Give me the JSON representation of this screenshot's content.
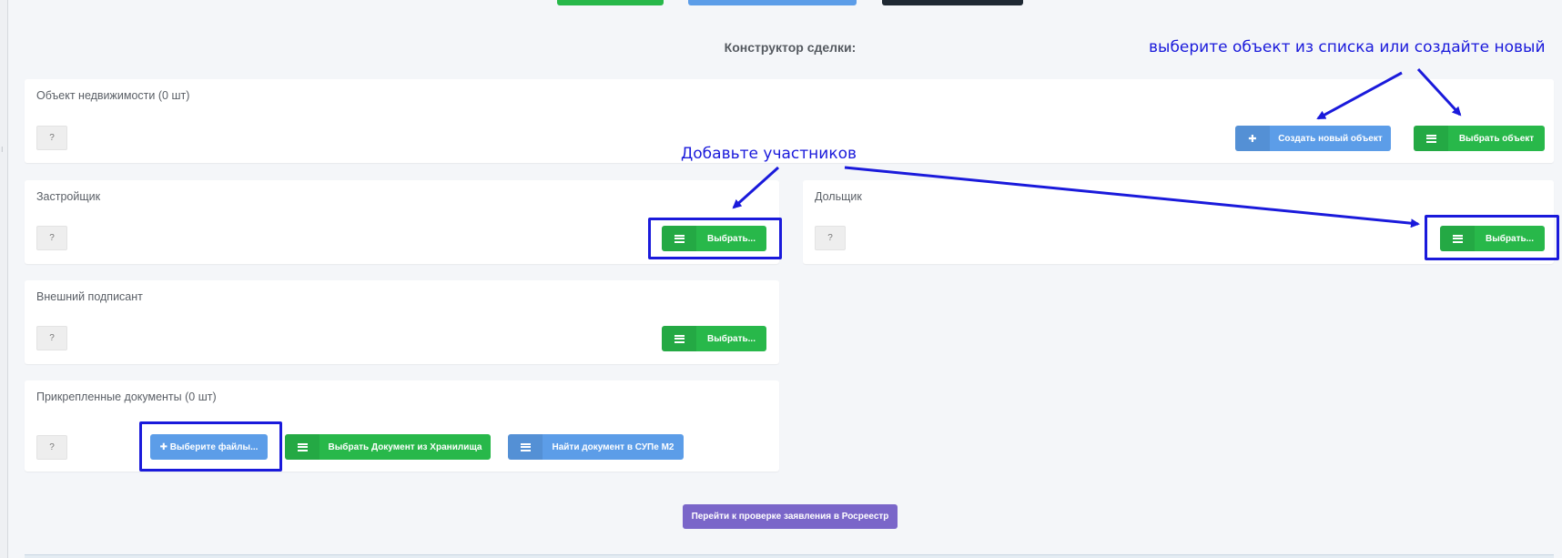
{
  "constructor_title": "Конструктор сделки:",
  "annotations": {
    "select_object_hint": "выберите объект из списка или создайте новый",
    "add_participants_hint": "Добавьте участников"
  },
  "colors": {
    "green": "#28b84a",
    "blue": "#5c9de8",
    "purple": "#7a66c9",
    "annotation": "#1a1adb"
  },
  "cards": {
    "property": {
      "title": "Объект недвижимости (0 шт)",
      "badge": "?",
      "create_button": "Создать новый объект",
      "select_button": "Выбрать объект"
    },
    "developer": {
      "title": "Застройщик",
      "badge": "?",
      "select_button": "Выбрать..."
    },
    "shareholder": {
      "title": "Дольщик",
      "badge": "?",
      "select_button": "Выбрать..."
    },
    "external_signer": {
      "title": "Внешний подписант",
      "badge": "?",
      "select_button": "Выбрать..."
    },
    "documents": {
      "title": "Прикрепленные документы (0 шт)",
      "badge": "?",
      "choose_files_button": "Выберите файлы...",
      "from_storage_button": "Выбрать Документ из Хранилища",
      "find_supe_button": "Найти документ в СУПе М2"
    }
  },
  "submit_button": "Перейти к проверке заявления в Росреестр",
  "icons": {
    "plus": "plus-icon",
    "list": "list-icon"
  }
}
